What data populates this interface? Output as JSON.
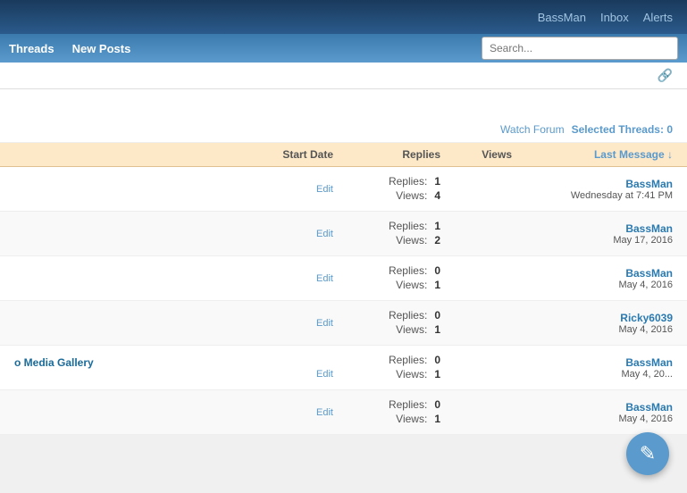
{
  "topNav": {
    "user": "BassMan",
    "inbox": "Inbox",
    "alerts": "Alerts"
  },
  "subNav": {
    "threads": "Threads",
    "newPosts": "New Posts"
  },
  "search": {
    "placeholder": "Search..."
  },
  "actionBar": {
    "watchForum": "Watch Forum",
    "selectedLabel": "Selected Threads:",
    "selectedCount": "0"
  },
  "tableHeader": {
    "startDate": "Start Date",
    "replies": "Replies",
    "views": "Views",
    "lastMessage": "Last Message ↓"
  },
  "threads": [
    {
      "title": "",
      "edit": "Edit",
      "replies_label": "Replies:",
      "replies_val": "1",
      "views_label": "Views:",
      "views_val": "4",
      "last_user": "BassMan",
      "last_date": "Wednesday at 7:41 PM"
    },
    {
      "title": "",
      "edit": "Edit",
      "replies_label": "Replies:",
      "replies_val": "1",
      "views_label": "Views:",
      "views_val": "2",
      "last_user": "BassMan",
      "last_date": "May 17, 2016"
    },
    {
      "title": "",
      "edit": "Edit",
      "replies_label": "Replies:",
      "replies_val": "0",
      "views_label": "Views:",
      "views_val": "1",
      "last_user": "BassMan",
      "last_date": "May 4, 2016"
    },
    {
      "title": "",
      "edit": "Edit",
      "replies_label": "Replies:",
      "replies_val": "0",
      "views_label": "Views:",
      "views_val": "1",
      "last_user": "Ricky6039",
      "last_date": "May 4, 2016"
    },
    {
      "title": "o Media Gallery",
      "edit": "Edit",
      "replies_label": "Replies:",
      "replies_val": "0",
      "views_label": "Views:",
      "views_val": "1",
      "last_user": "BassMan",
      "last_date": "May 4, 20..."
    },
    {
      "title": "",
      "edit": "Edit",
      "replies_label": "Replies:",
      "replies_val": "0",
      "views_label": "Views:",
      "views_val": "1",
      "last_user": "BassMan",
      "last_date": "May 4, 2016"
    }
  ],
  "fab": {
    "icon": "✎"
  }
}
